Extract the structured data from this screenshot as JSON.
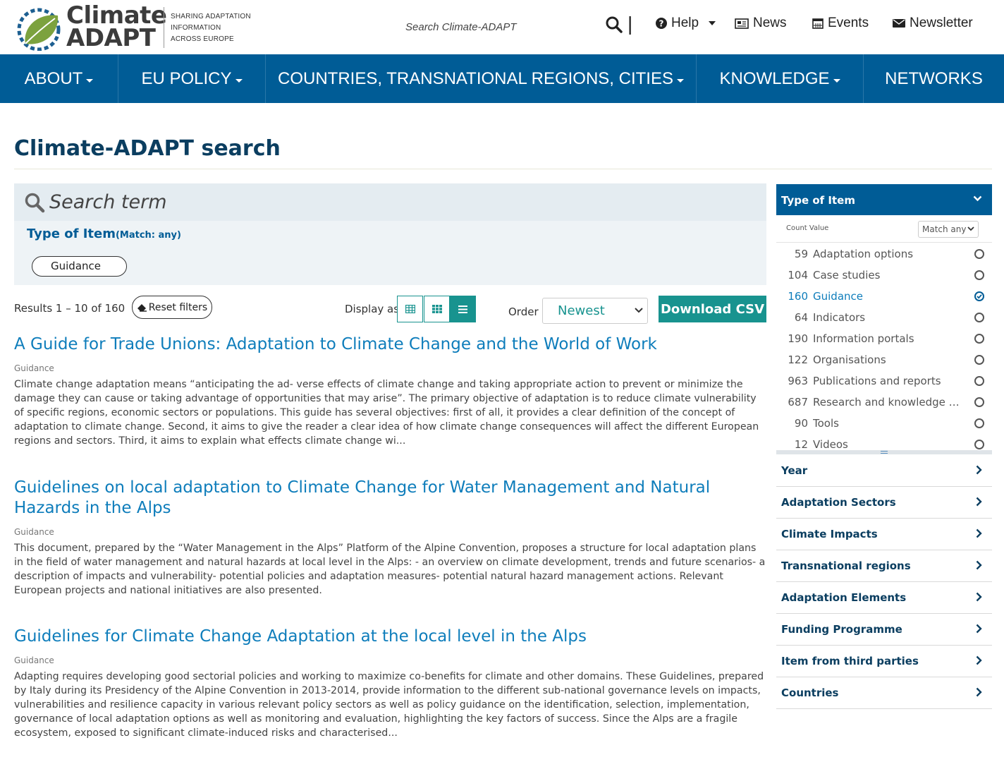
{
  "header": {
    "logo_line1": "Climate",
    "logo_line2": "ADAPT",
    "tagline": [
      "SHARING ADAPTATION",
      "INFORMATION",
      "ACROSS EUROPE"
    ],
    "search_placeholder": "Search Climate-ADAPT",
    "links": {
      "help": "Help",
      "news": "News",
      "events": "Events",
      "newsletter": "Newsletter"
    }
  },
  "nav": {
    "items": [
      {
        "label": "ABOUT",
        "has_caret": true
      },
      {
        "label": "EU POLICY",
        "has_caret": true
      },
      {
        "label": "COUNTRIES, TRANSNATIONAL REGIONS, CITIES",
        "has_caret": true
      },
      {
        "label": "KNOWLEDGE",
        "has_caret": true
      },
      {
        "label": "NETWORKS",
        "has_caret": false
      }
    ]
  },
  "page": {
    "title": "Climate-ADAPT search"
  },
  "search": {
    "placeholder": "Search term",
    "facet_title": "Type of Item",
    "facet_match": "(Match: any)",
    "active_chip": "Guidance"
  },
  "toolbar": {
    "results": "Results 1 – 10 of 160",
    "reset": "Reset filters",
    "display_as": "Display as",
    "order_label": "Order",
    "order_value": "Newest",
    "download": "Download CSV"
  },
  "results": [
    {
      "title": "A Guide for Trade Unions: Adaptation to Climate Change and the World of Work",
      "type": "Guidance",
      "description": "Climate change adaptation means “anticipating the ad- verse effects of climate change and taking appropriate action to prevent or minimize the damage they can cause or taking advantage of opportunities that may arise”. The primary objective of adaptation is to reduce climate vulnerability of specific regions, economic sectors or populations. This guide has several objectives: first of all, it provides a clear definition of the concept of adaptation to climate change. Second, it aims to give the reader a clear idea of how climate change consequences will affect the different European regions and sectors. Third, it aims to explain what effects climate change wi..."
    },
    {
      "title": "Guidelines on local adaptation to Climate Change for Water Management and Natural Hazards in the Alps",
      "type": "Guidance",
      "description": "This document, prepared by the “Water Management in the Alps” Platform of the Alpine Convention, proposes a structure for local adaptation plans in the field of water management and natural hazards at local level in the Alps: - an overview on climate development, trends and future scenarios- a description of impacts and vulnerability- potential policies and adaptation measures- potential natural hazard management actions. Relevant European projects and national initiatives are also presented."
    },
    {
      "title": "Guidelines for Climate Change Adaptation at the local level in the Alps",
      "type": "Guidance",
      "description": "Adapting requires developing good sectorial policies and working to maximize co-benefits for climate and other domains. These Guidelines, prepared by Italy during its Presidency of the Alpine Convention in 2013-2014, provide information to the different sub-national governance levels on impacts, vulnerabilities and resilience capacity in various relevant policy sectors as well as policy guidance on the identification, selection, implementation, governance of local adaptation options as well as monitoring and evaluation, highlighting the key factors of success. Since the Alps are a fragile ecosystem, exposed to significant climate-induced risks and characterised..."
    }
  ],
  "sidebar": {
    "type_header": "Type of Item",
    "count_value": "Count Value",
    "match_select": "Match any",
    "facets": [
      {
        "count": "59",
        "label": "Adaptation options",
        "selected": false
      },
      {
        "count": "104",
        "label": "Case studies",
        "selected": false
      },
      {
        "count": "160",
        "label": "Guidance",
        "selected": true
      },
      {
        "count": "64",
        "label": "Indicators",
        "selected": false
      },
      {
        "count": "190",
        "label": "Information portals",
        "selected": false
      },
      {
        "count": "122",
        "label": "Organisations",
        "selected": false
      },
      {
        "count": "963",
        "label": "Publications and reports",
        "selected": false
      },
      {
        "count": "687",
        "label": "Research and knowledge projects",
        "selected": false
      },
      {
        "count": "90",
        "label": "Tools",
        "selected": false
      },
      {
        "count": "12",
        "label": "Videos",
        "selected": false
      }
    ],
    "accordions": [
      "Year",
      "Adaptation Sectors",
      "Climate Impacts",
      "Transnational regions",
      "Adaptation Elements",
      "Funding Programme",
      "Item from third parties",
      "Countries"
    ]
  },
  "colors": {
    "nav_blue": "#005c96",
    "teal": "#18938f",
    "link_blue": "#0e7dbb",
    "title_navy": "#0b3e60"
  }
}
